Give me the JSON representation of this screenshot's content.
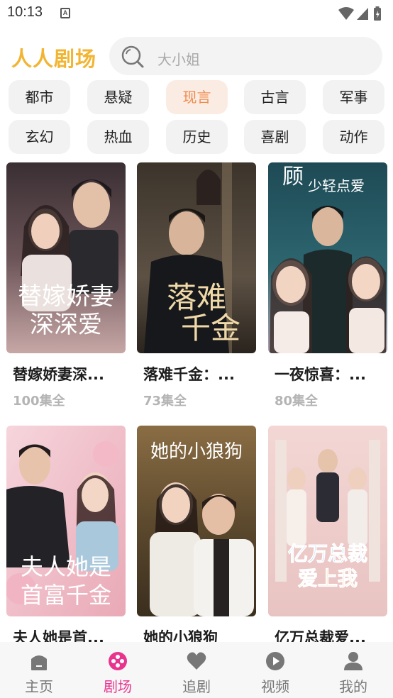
{
  "status_bar": {
    "time": "10:13",
    "notification_letter": "A"
  },
  "header": {
    "app_title": "人人剧场",
    "search_placeholder": "大小姐"
  },
  "categories": [
    {
      "label": "都市",
      "active": false
    },
    {
      "label": "悬疑",
      "active": false
    },
    {
      "label": "现言",
      "active": true
    },
    {
      "label": "古言",
      "active": false
    },
    {
      "label": "军事",
      "active": false
    },
    {
      "label": "玄幻",
      "active": false
    },
    {
      "label": "热血",
      "active": false
    },
    {
      "label": "历史",
      "active": false
    },
    {
      "label": "喜剧",
      "active": false
    },
    {
      "label": "动作",
      "active": false
    }
  ],
  "dramas": [
    {
      "title": "替嫁娇妻深...",
      "episodes": "100集全",
      "poster_text": [
        "替嫁娇妻",
        "深深爱"
      ]
    },
    {
      "title": "落难千金：...",
      "episodes": "73集全",
      "poster_text": [
        "落难",
        "千金"
      ]
    },
    {
      "title": "一夜惊喜：...",
      "episodes": "80集全",
      "poster_text": [
        "顾",
        "少轻点爱"
      ]
    },
    {
      "title": "夫人她是首...",
      "episodes": "",
      "poster_text": [
        "夫人她是",
        "首富千金"
      ]
    },
    {
      "title": "她的小狼狗",
      "episodes": "",
      "poster_text": [
        "她的小狼狗"
      ]
    },
    {
      "title": "亿万总裁爱...",
      "episodes": "",
      "poster_text": [
        "亿万总裁",
        "爱上我"
      ]
    }
  ],
  "bottom_nav": [
    {
      "label": "主页",
      "icon": "home-icon",
      "active": false
    },
    {
      "label": "剧场",
      "icon": "theater-icon",
      "active": true
    },
    {
      "label": "追剧",
      "icon": "heart-icon",
      "active": false
    },
    {
      "label": "视频",
      "icon": "play-icon",
      "active": false
    },
    {
      "label": "我的",
      "icon": "profile-icon",
      "active": false
    }
  ],
  "colors": {
    "brand": "#f2b533",
    "active_category_bg": "#fbece3",
    "active_category_text": "#ef8b4d",
    "active_nav": "#e9348d"
  }
}
